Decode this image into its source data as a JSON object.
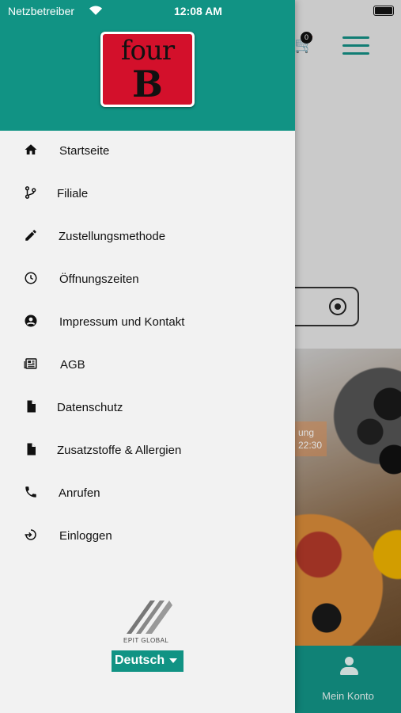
{
  "status_bar": {
    "carrier": "Netzbetreiber",
    "time": "12:08 AM"
  },
  "logo": {
    "line1": "four",
    "line2": "B"
  },
  "background": {
    "cart_count": "0",
    "badge_text_1": "ung",
    "badge_text_2": "22:30",
    "tab_label": "Mein Konto"
  },
  "menu": {
    "items": [
      {
        "label": "Startseite",
        "icon": "home-icon"
      },
      {
        "label": "Filiale",
        "icon": "branch-icon"
      },
      {
        "label": "Zustellungsmethode",
        "icon": "pencil-icon"
      },
      {
        "label": "Öffnungszeiten",
        "icon": "clock-icon"
      },
      {
        "label": "Impressum und Kontakt",
        "icon": "account-circle-icon"
      },
      {
        "label": "AGB",
        "icon": "newspaper-icon"
      },
      {
        "label": "Datenschutz",
        "icon": "document-icon"
      },
      {
        "label": "Zusatzstoffe & Allergien",
        "icon": "document-icon"
      },
      {
        "label": "Anrufen",
        "icon": "phone-icon"
      },
      {
        "label": "Einloggen",
        "icon": "login-icon"
      }
    ]
  },
  "footer": {
    "brand": "EPIT GLOBAL",
    "language": "Deutsch"
  },
  "colors": {
    "accent": "#119384",
    "logo_red": "#d3102b"
  }
}
